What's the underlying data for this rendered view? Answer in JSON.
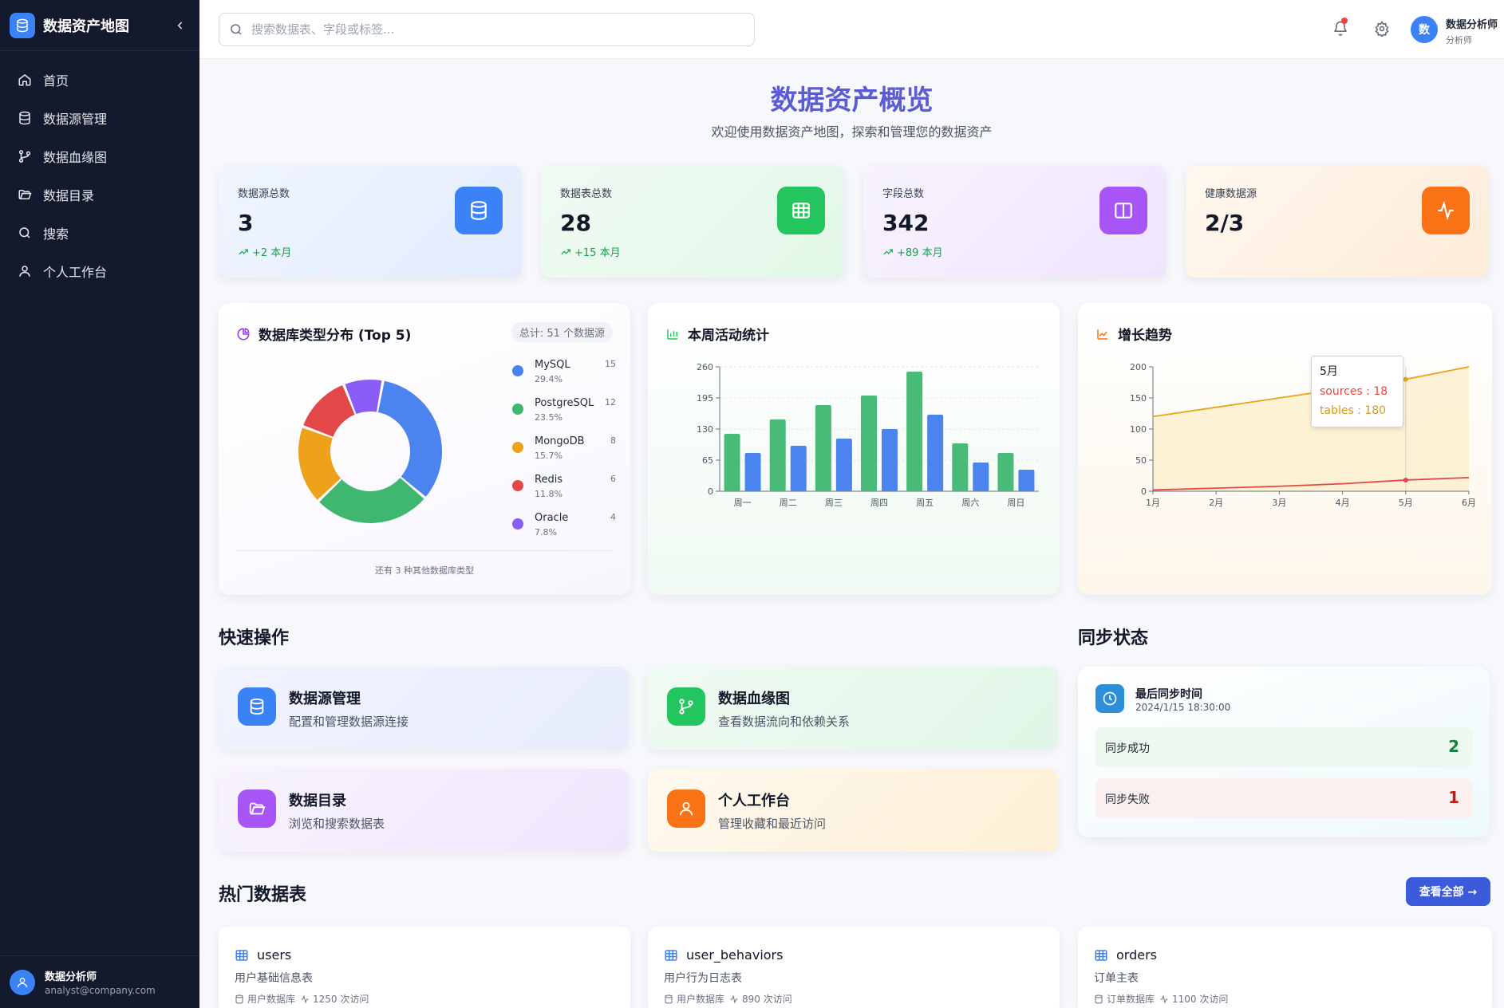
{
  "app": {
    "title": "数据资产地图"
  },
  "sidebar": {
    "items": [
      {
        "label": "首页"
      },
      {
        "label": "数据源管理"
      },
      {
        "label": "数据血缘图"
      },
      {
        "label": "数据目录"
      },
      {
        "label": "搜索"
      },
      {
        "label": "个人工作台"
      }
    ],
    "user": {
      "name": "数据分析师",
      "email": "analyst@company.com"
    }
  },
  "topbar": {
    "search_placeholder": "搜索数据表、字段或标签...",
    "avatar_letter": "数",
    "user_name": "数据分析师",
    "user_role": "分析师"
  },
  "page": {
    "title": "数据资产概览",
    "subtitle": "欢迎使用数据资产地图，探索和管理您的数据资产"
  },
  "stats": [
    {
      "label": "数据源总数",
      "value": "3",
      "trend": "+2 本月",
      "color": "#3b82f6"
    },
    {
      "label": "数据表总数",
      "value": "28",
      "trend": "+15 本月",
      "color": "#22c55e"
    },
    {
      "label": "字段总数",
      "value": "342",
      "trend": "+89 本月",
      "color": "#a855f7"
    },
    {
      "label": "健康数据源",
      "value": "2/3",
      "trend": "",
      "color": "#f97316"
    }
  ],
  "donut": {
    "title": "数据库类型分布 (Top 5)",
    "total": "总计: 51 个数据源",
    "footer": "还有 3 种其他数据库类型"
  },
  "activity": {
    "title": "本周活动统计"
  },
  "trend": {
    "title": "增长趋势",
    "tooltip": {
      "month": "5月",
      "sources": "sources : 18",
      "tables": "tables : 180"
    }
  },
  "chart_data": [
    {
      "type": "pie",
      "title": "数据库类型分布 (Top 5)",
      "categories": [
        "MySQL",
        "PostgreSQL",
        "MongoDB",
        "Redis",
        "Oracle"
      ],
      "values": [
        15,
        12,
        8,
        6,
        4
      ],
      "percents": [
        "29.4%",
        "23.5%",
        "15.7%",
        "11.8%",
        "7.8%"
      ],
      "colors": [
        "#4b84ee",
        "#3fb770",
        "#eea21c",
        "#e34848",
        "#8b5cf6"
      ]
    },
    {
      "type": "bar",
      "title": "本周活动统计",
      "categories": [
        "周一",
        "周二",
        "周三",
        "周四",
        "周五",
        "周六",
        "周日"
      ],
      "series": [
        {
          "values": [
            120,
            150,
            180,
            200,
            250,
            100,
            80
          ],
          "color": "#48bb78"
        },
        {
          "values": [
            80,
            95,
            110,
            130,
            160,
            60,
            45
          ],
          "color": "#4b84ee"
        }
      ],
      "yticks": [
        0,
        65,
        130,
        195,
        260
      ],
      "ylim": [
        0,
        260
      ]
    },
    {
      "type": "line",
      "title": "增长趋势",
      "categories": [
        "1月",
        "2月",
        "3月",
        "4月",
        "5月",
        "6月"
      ],
      "series": [
        {
          "name": "sources",
          "values": [
            2,
            5,
            8,
            12,
            18,
            22
          ],
          "color": "#e34848"
        },
        {
          "name": "tables",
          "values": [
            120,
            135,
            150,
            165,
            180,
            200
          ],
          "color": "#e8a51a"
        }
      ],
      "yticks": [
        0,
        50,
        100,
        150,
        200
      ],
      "ylim": [
        0,
        200
      ]
    }
  ],
  "quick_actions": {
    "title": "快速操作",
    "items": [
      {
        "title": "数据源管理",
        "desc": "配置和管理数据源连接"
      },
      {
        "title": "数据血缘图",
        "desc": "查看数据流向和依赖关系"
      },
      {
        "title": "数据目录",
        "desc": "浏览和搜索数据表"
      },
      {
        "title": "个人工作台",
        "desc": "管理收藏和最近访问"
      }
    ]
  },
  "sync": {
    "title": "同步状态",
    "last_label": "最后同步时间",
    "last_time": "2024/1/15 18:30:00",
    "success_label": "同步成功",
    "success_count": "2",
    "fail_label": "同步失败",
    "fail_count": "1"
  },
  "hot_tables": {
    "title": "热门数据表",
    "view_all": "查看全部 →",
    "items": [
      {
        "name": "users",
        "desc": "用户基础信息表",
        "db": "用户数据库",
        "visits": "1250 次访问"
      },
      {
        "name": "user_behaviors",
        "desc": "用户行为日志表",
        "db": "用户数据库",
        "visits": "890 次访问"
      },
      {
        "name": "orders",
        "desc": "订单主表",
        "db": "订单数据库",
        "visits": "1100 次访问"
      }
    ]
  }
}
